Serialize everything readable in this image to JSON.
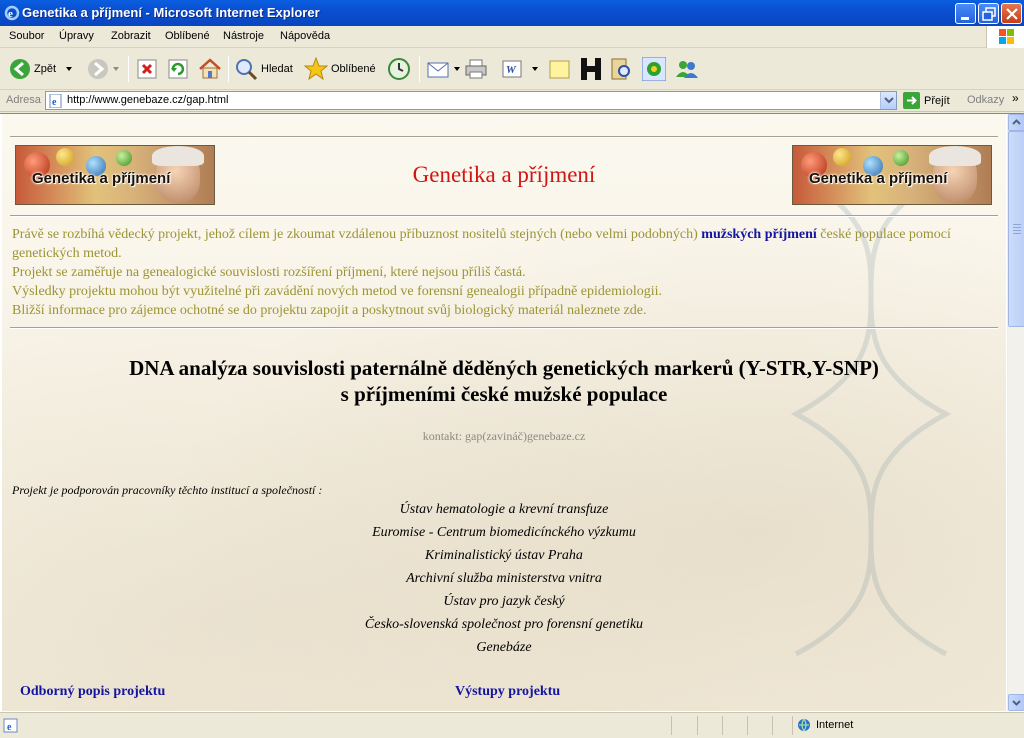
{
  "window": {
    "title": "Genetika a příjmení - Microsoft Internet Explorer"
  },
  "menu": [
    "Soubor",
    "Úpravy",
    "Zobrazit",
    "Oblíbené",
    "Nástroje",
    "Nápověda"
  ],
  "toolbar": {
    "back": "Zpět",
    "search": "Hledat",
    "favorites": "Oblíbené"
  },
  "address": {
    "label": "Adresa",
    "url": "http://www.genebaze.cz/gap.html",
    "go": "Přejít",
    "links": "Odkazy"
  },
  "page": {
    "banner_text": "Genetika a příjmení",
    "title": "Genetika a příjmení",
    "intro_1a": "Právě se rozbíhá vědecký projekt, jehož cílem je zkoumat vzdálenou příbuznost nositelů stejných (nebo velmi podobných)",
    "intro_link": "mužských příjmení",
    "intro_1b": "české populace pomocí genetických metod.",
    "intro_2": "Projekt se zaměřuje na genealogické souvislosti rozšíření příjmení, které nejsou příliš častá.",
    "intro_3": "Výsledky projektu mohou být využitelné při zavádění nových metod ve forensní genealogii případně epidemiologii.",
    "intro_4": "Bližší informace pro zájemce ochotné se do projektu zapojit a poskytnout svůj biologický materiál naleznete zde.",
    "heading_1": "DNA analýza souvislosti paternálně děděných genetických markerů (Y-STR,Y-SNP)",
    "heading_2": "s příjmeními české mužské populace",
    "contact": "kontakt: gap(zavináč)genebaze.cz",
    "support_label": "Projekt je podporován pracovníky těchto institucí a společností :",
    "institutions": [
      "Ústav hematologie a krevní transfuze",
      "Euromise - Centrum biomedicínckého výzkumu",
      "Kriminalistický ústav Praha",
      "Archivní služba ministerstva vnitra",
      "Ústav pro jazyk český",
      "Česko-slovenská společnost pro forensní genetiku",
      "Genebáze"
    ],
    "link_description": "Odborný popis projektu",
    "link_outputs": "Výstupy projektu"
  },
  "status": {
    "zone": "Internet"
  },
  "colors": {
    "title_red": "#d21414",
    "intro_olive": "#9c9434",
    "link_blue": "#1414a0",
    "xp_blue": "#0b4fd0"
  }
}
